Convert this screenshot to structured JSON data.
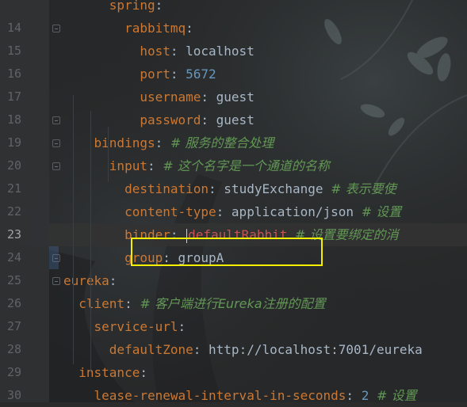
{
  "editor": {
    "current_line": "23",
    "highlight_color": "#f6f000",
    "lines": [
      {
        "num": "",
        "indent": "      ",
        "tokens": [
          {
            "t": "key",
            "v": "spring"
          },
          {
            "t": "punct",
            "v": ":"
          }
        ]
      },
      {
        "num": "14",
        "indent": "        ",
        "tokens": [
          {
            "t": "key",
            "v": "rabbitmq"
          },
          {
            "t": "punct",
            "v": ":"
          }
        ]
      },
      {
        "num": "15",
        "indent": "          ",
        "tokens": [
          {
            "t": "key",
            "v": "host"
          },
          {
            "t": "punct",
            "v": ": "
          },
          {
            "t": "val",
            "v": "localhost"
          }
        ]
      },
      {
        "num": "16",
        "indent": "          ",
        "tokens": [
          {
            "t": "key",
            "v": "port"
          },
          {
            "t": "punct",
            "v": ": "
          },
          {
            "t": "num",
            "v": "5672"
          }
        ]
      },
      {
        "num": "17",
        "indent": "          ",
        "tokens": [
          {
            "t": "key",
            "v": "username"
          },
          {
            "t": "punct",
            "v": ": "
          },
          {
            "t": "val",
            "v": "guest"
          }
        ]
      },
      {
        "num": "18",
        "indent": "          ",
        "tokens": [
          {
            "t": "key",
            "v": "password"
          },
          {
            "t": "punct",
            "v": ": "
          },
          {
            "t": "val",
            "v": "guest"
          }
        ]
      },
      {
        "num": "19",
        "indent": "    ",
        "tokens": [
          {
            "t": "key",
            "v": "bindings"
          },
          {
            "t": "punct",
            "v": ": "
          },
          {
            "t": "comment",
            "v": "# 服务的整合处理"
          }
        ]
      },
      {
        "num": "20",
        "indent": "      ",
        "tokens": [
          {
            "t": "key",
            "v": "input"
          },
          {
            "t": "punct",
            "v": ": "
          },
          {
            "t": "comment",
            "v": "# 这个名字是一个通道的名称"
          }
        ]
      },
      {
        "num": "21",
        "indent": "        ",
        "tokens": [
          {
            "t": "key",
            "v": "destination"
          },
          {
            "t": "punct",
            "v": ": "
          },
          {
            "t": "val",
            "v": "studyExchange "
          },
          {
            "t": "comment",
            "v": "# 表示要使"
          }
        ]
      },
      {
        "num": "22",
        "indent": "        ",
        "tokens": [
          {
            "t": "key",
            "v": "content-type"
          },
          {
            "t": "punct",
            "v": ": "
          },
          {
            "t": "val",
            "v": "application/json "
          },
          {
            "t": "comment",
            "v": "# 设置"
          }
        ]
      },
      {
        "num": "23",
        "indent": "        ",
        "tokens": [
          {
            "t": "key",
            "v": "binder"
          },
          {
            "t": "punct",
            "v": ": "
          },
          {
            "t": "caret",
            "v": ""
          },
          {
            "t": "error",
            "v": "defaultRabbit"
          },
          {
            "t": "val",
            "v": " "
          },
          {
            "t": "comment",
            "v": "# 设置要绑定的消"
          }
        ]
      },
      {
        "num": "24",
        "indent": "        ",
        "tokens": [
          {
            "t": "key",
            "v": "group"
          },
          {
            "t": "punct",
            "v": ": "
          },
          {
            "t": "val",
            "v": "groupA"
          }
        ]
      },
      {
        "num": "25",
        "indent": "",
        "tokens": [
          {
            "t": "key",
            "v": "eureka"
          },
          {
            "t": "punct",
            "v": ":"
          }
        ]
      },
      {
        "num": "26",
        "indent": "  ",
        "tokens": [
          {
            "t": "key",
            "v": "client"
          },
          {
            "t": "punct",
            "v": ": "
          },
          {
            "t": "comment",
            "v": "# 客户端进行Eureka注册的配置"
          }
        ]
      },
      {
        "num": "27",
        "indent": "    ",
        "tokens": [
          {
            "t": "key",
            "v": "service-url"
          },
          {
            "t": "punct",
            "v": ":"
          }
        ]
      },
      {
        "num": "28",
        "indent": "      ",
        "tokens": [
          {
            "t": "key",
            "v": "defaultZone"
          },
          {
            "t": "punct",
            "v": ": "
          },
          {
            "t": "val",
            "v": "http://localhost:7001/eureka"
          }
        ]
      },
      {
        "num": "29",
        "indent": "  ",
        "tokens": [
          {
            "t": "key",
            "v": "instance"
          },
          {
            "t": "punct",
            "v": ":"
          }
        ]
      },
      {
        "num": "30",
        "indent": "    ",
        "tokens": [
          {
            "t": "key",
            "v": "lease-renewal-interval-in-seconds"
          },
          {
            "t": "punct",
            "v": ": "
          },
          {
            "t": "num",
            "v": "2"
          },
          {
            "t": "val",
            "v": " "
          },
          {
            "t": "comment",
            "v": "# 设置"
          }
        ]
      }
    ]
  }
}
